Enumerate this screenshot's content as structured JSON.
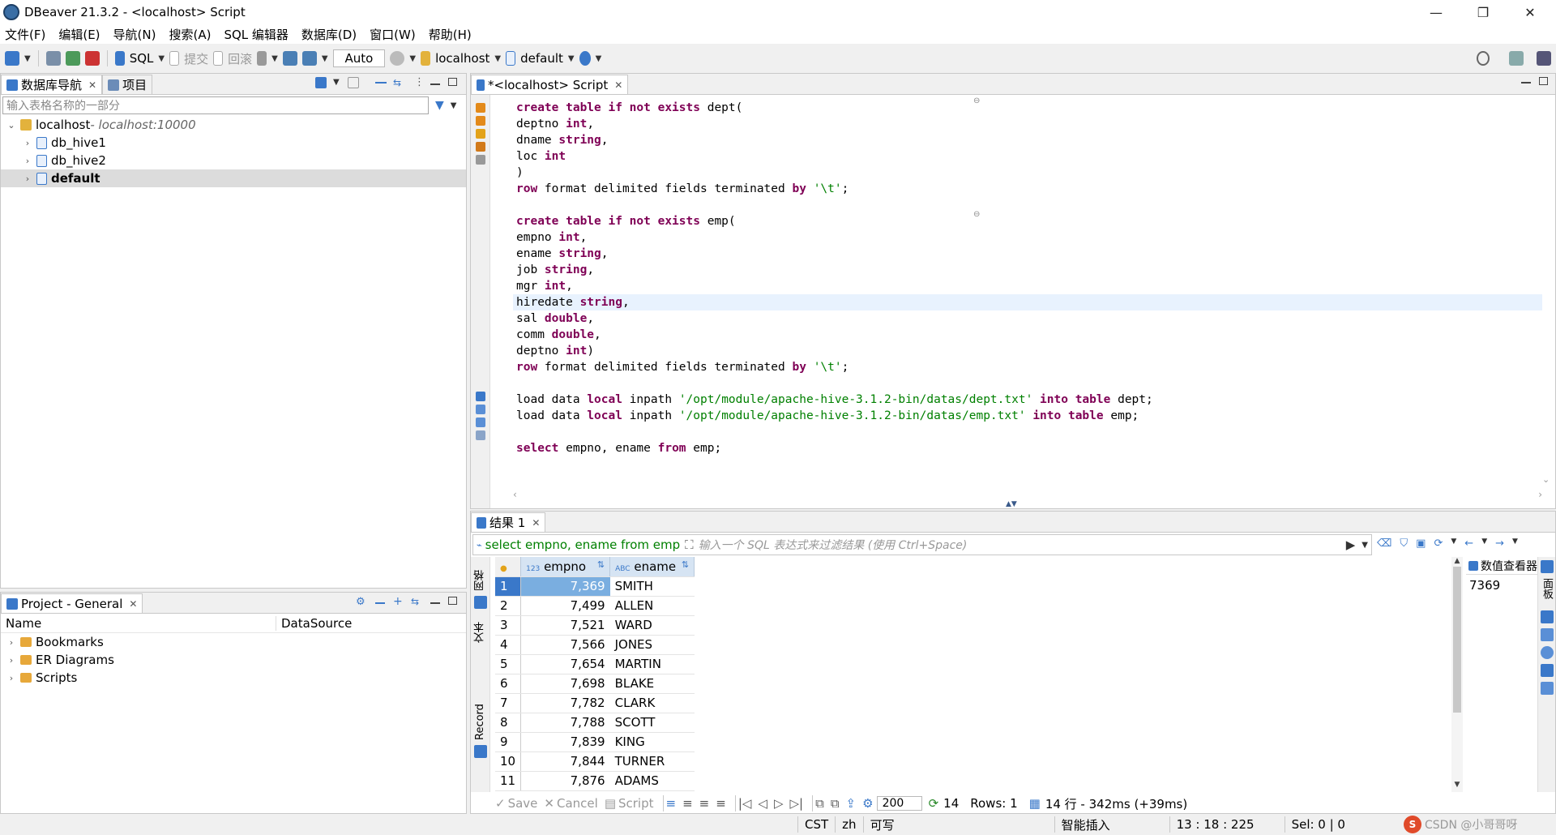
{
  "window": {
    "title": "DBeaver 21.3.2 - <localhost> Script",
    "minimize": "—",
    "restore": "❐",
    "close": "✕"
  },
  "menu": [
    "文件(F)",
    "编辑(E)",
    "导航(N)",
    "搜索(A)",
    "SQL 编辑器",
    "数据库(D)",
    "窗口(W)",
    "帮助(H)"
  ],
  "toolbar": {
    "sql_label": "SQL",
    "commit_label": "提交",
    "rollback_label": "回滚",
    "auto_label": "Auto",
    "connection_label": "localhost",
    "schema_label": "default"
  },
  "navigator": {
    "tab_db": "数据库导航",
    "tab_project": "项目",
    "filter_placeholder": "输入表格名称的一部分",
    "root": {
      "label": "localhost",
      "detail": " - localhost:10000"
    },
    "children": [
      "db_hive1",
      "db_hive2",
      "default"
    ]
  },
  "project_panel": {
    "tab": "Project - General",
    "col_name": "Name",
    "col_datasource": "DataSource",
    "items": [
      "Bookmarks",
      "ER Diagrams",
      "Scripts"
    ]
  },
  "editor": {
    "tab": "*<localhost> Script",
    "lines": [
      [
        [
          "kw",
          "create table if not exists"
        ],
        [
          "t",
          " dept("
        ]
      ],
      [
        [
          "t",
          "deptno "
        ],
        [
          "kw",
          "int"
        ],
        [
          "t",
          ","
        ]
      ],
      [
        [
          "t",
          "dname "
        ],
        [
          "kw",
          "string"
        ],
        [
          "t",
          ","
        ]
      ],
      [
        [
          "t",
          "loc "
        ],
        [
          "kw",
          "int"
        ]
      ],
      [
        [
          "t",
          ")"
        ]
      ],
      [
        [
          "kw",
          "row"
        ],
        [
          "t",
          " format delimited fields terminated "
        ],
        [
          "kw",
          "by"
        ],
        [
          "t",
          " "
        ],
        [
          "str",
          "'\\t'"
        ],
        [
          "t",
          ";"
        ]
      ],
      [
        [
          "t",
          ""
        ]
      ],
      [
        [
          "kw",
          "create table if not exists"
        ],
        [
          "t",
          " emp("
        ]
      ],
      [
        [
          "t",
          "empno "
        ],
        [
          "kw",
          "int"
        ],
        [
          "t",
          ","
        ]
      ],
      [
        [
          "t",
          "ename "
        ],
        [
          "kw",
          "string"
        ],
        [
          "t",
          ","
        ]
      ],
      [
        [
          "t",
          "job "
        ],
        [
          "kw",
          "string"
        ],
        [
          "t",
          ","
        ]
      ],
      [
        [
          "t",
          "mgr "
        ],
        [
          "kw",
          "int"
        ],
        [
          "t",
          ","
        ]
      ],
      [
        [
          "t",
          "hiredate "
        ],
        [
          "kw",
          "string"
        ],
        [
          "t",
          ","
        ]
      ],
      [
        [
          "t",
          "sal "
        ],
        [
          "kw",
          "double"
        ],
        [
          "t",
          ","
        ]
      ],
      [
        [
          "t",
          "comm "
        ],
        [
          "kw",
          "double"
        ],
        [
          "t",
          ","
        ]
      ],
      [
        [
          "t",
          "deptno "
        ],
        [
          "kw",
          "int"
        ],
        [
          "t",
          ")"
        ]
      ],
      [
        [
          "kw",
          "row"
        ],
        [
          "t",
          " format delimited fields terminated "
        ],
        [
          "kw",
          "by"
        ],
        [
          "t",
          " "
        ],
        [
          "str",
          "'\\t'"
        ],
        [
          "t",
          ";"
        ]
      ],
      [
        [
          "t",
          ""
        ]
      ],
      [
        [
          "t",
          "load data "
        ],
        [
          "kw",
          "local"
        ],
        [
          "t",
          " inpath "
        ],
        [
          "str",
          "'/opt/module/apache-hive-3.1.2-bin/datas/dept.txt'"
        ],
        [
          "t",
          " "
        ],
        [
          "kw",
          "into table"
        ],
        [
          "t",
          " dept;"
        ]
      ],
      [
        [
          "t",
          "load data "
        ],
        [
          "kw",
          "local"
        ],
        [
          "t",
          " inpath "
        ],
        [
          "str",
          "'/opt/module/apache-hive-3.1.2-bin/datas/emp.txt'"
        ],
        [
          "t",
          " "
        ],
        [
          "kw",
          "into table"
        ],
        [
          "t",
          " emp;"
        ]
      ],
      [
        [
          "t",
          ""
        ]
      ],
      [
        [
          "kw",
          "select"
        ],
        [
          "t",
          " empno, ename "
        ],
        [
          "kw",
          "from"
        ],
        [
          "t",
          " emp;"
        ]
      ]
    ]
  },
  "results": {
    "tab": "结果 1",
    "query_label": "select empno, ename from emp",
    "filter_placeholder": "输入一个 SQL 表达式来过滤结果 (使用 Ctrl+Space)",
    "columns": [
      "empno",
      "ename"
    ],
    "rows": [
      [
        "1",
        "7,369",
        "SMITH"
      ],
      [
        "2",
        "7,499",
        "ALLEN"
      ],
      [
        "3",
        "7,521",
        "WARD"
      ],
      [
        "4",
        "7,566",
        "JONES"
      ],
      [
        "5",
        "7,654",
        "MARTIN"
      ],
      [
        "6",
        "7,698",
        "BLAKE"
      ],
      [
        "7",
        "7,782",
        "CLARK"
      ],
      [
        "8",
        "7,788",
        "SCOTT"
      ],
      [
        "9",
        "7,839",
        "KING"
      ],
      [
        "10",
        "7,844",
        "TURNER"
      ],
      [
        "11",
        "7,876",
        "ADAMS"
      ]
    ],
    "side_grid": "网格",
    "side_text": "文本",
    "side_record": "Record",
    "viewer_tab": "数值查看器",
    "viewer_value": "7369",
    "side_panel": "面板",
    "save": "Save",
    "cancel": "Cancel",
    "script": "Script",
    "fetch_size": "200",
    "rows_count": "14",
    "rows_label": "Rows: 1",
    "exec_info": "14 行 - 342ms (+39ms)"
  },
  "status": {
    "tz": "CST",
    "locale": "zh",
    "writable": "可写",
    "insert_mode": "智能插入",
    "cursor": "13 : 18 : 225",
    "selection": "Sel: 0 | 0",
    "watermark": "CSDN @小哥哥呀"
  },
  "colors": {
    "keyword": "#7f0055",
    "string": "#008000",
    "selection": "#dbe8f6",
    "accent": "#3a78c9"
  }
}
